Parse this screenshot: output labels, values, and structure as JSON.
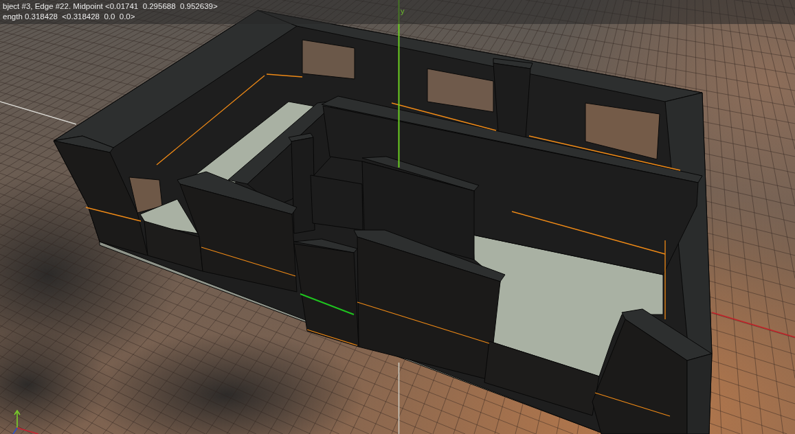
{
  "info_bar": {
    "selection_text": "bject #3, Edge #22. Midpoint <0.01741  0.295688  0.952639>",
    "length_text": "ength 0.318428  <0.318428  0.0  0.0>"
  },
  "viewport": {
    "axis_label": "y"
  }
}
